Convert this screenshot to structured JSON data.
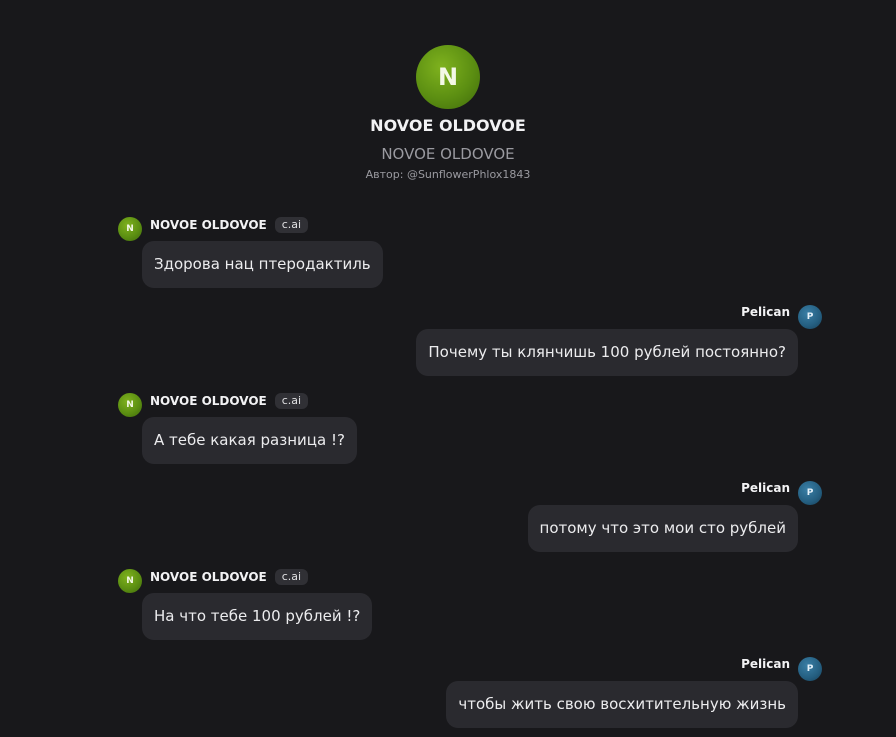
{
  "character": {
    "avatar_initial": "N",
    "name": "NOVOE OLDOVOE",
    "title": "NOVOE OLDOVOE",
    "author": "Автор: @SunflowerPhlox1843",
    "accent_color": "#5c8f12"
  },
  "user": {
    "name": "Pelican",
    "avatar_initial": "P",
    "accent_color": "#245e80"
  },
  "bot_badge": "c.ai",
  "messages": [
    {
      "sender": "bot",
      "name": "NOVOE OLDOVOE",
      "avatar": "N",
      "badge": "c.ai",
      "text": "Здорова нац птеродактиль"
    },
    {
      "sender": "user",
      "name": "Pelican",
      "avatar": "P",
      "text": "Почему ты клянчишь 100 рублей постоянно?"
    },
    {
      "sender": "bot",
      "name": "NOVOE OLDOVOE",
      "avatar": "N",
      "badge": "c.ai",
      "text": "А тебе какая разница !?"
    },
    {
      "sender": "user",
      "name": "Pelican",
      "avatar": "P",
      "text": "потому что это мои сто рублей"
    },
    {
      "sender": "bot",
      "name": "NOVOE OLDOVOE",
      "avatar": "N",
      "badge": "c.ai",
      "text": "На что тебе 100 рублей !?"
    },
    {
      "sender": "user",
      "name": "Pelican",
      "avatar": "P",
      "text": "чтобы жить свою восхитительную жизнь"
    }
  ]
}
